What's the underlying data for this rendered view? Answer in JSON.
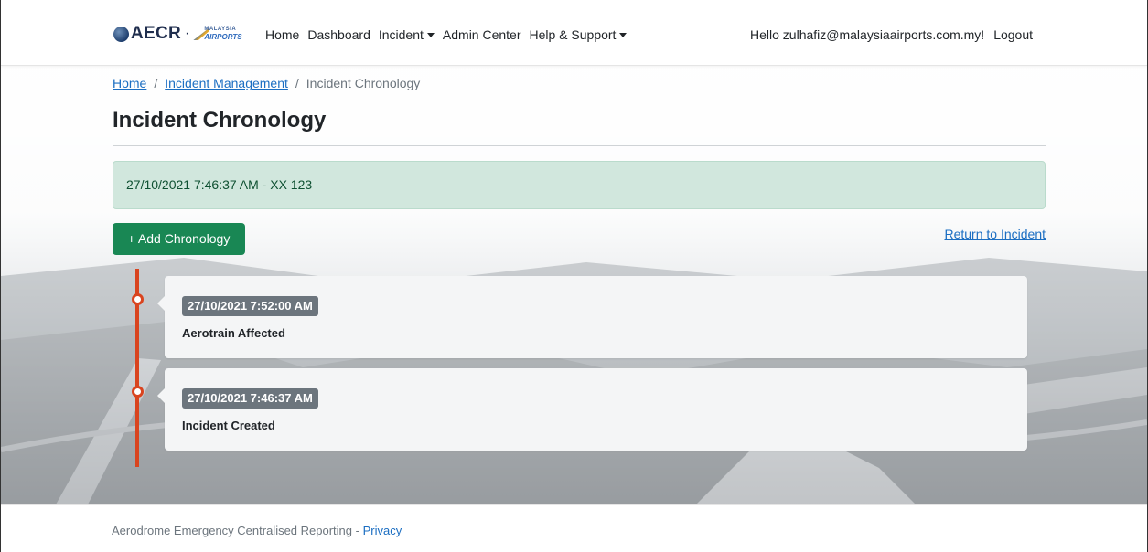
{
  "navbar": {
    "brand": {
      "text": "AECR",
      "separator": "·",
      "logo_small_text": "MALAYSIA",
      "logo_text": "AIRPORTS"
    },
    "links": {
      "home": "Home",
      "dashboard": "Dashboard",
      "incident": "Incident",
      "admin_center": "Admin Center",
      "help_support": "Help & Support"
    },
    "greeting": "Hello zulhafiz@malaysiaairports.com.my!",
    "logout": "Logout"
  },
  "breadcrumb": {
    "home": "Home",
    "incident_management": "Incident Management",
    "current": "Incident Chronology",
    "separator": "/"
  },
  "page": {
    "title": "Incident Chronology",
    "alert_text": "27/10/2021 7:46:37 AM - XX 123",
    "add_button": "+ Add Chronology",
    "return_link": "Return to Incident"
  },
  "timeline": [
    {
      "timestamp": "27/10/2021 7:52:00 AM",
      "description": "Aerotrain Affected"
    },
    {
      "timestamp": "27/10/2021 7:46:37 AM",
      "description": "Incident Created"
    }
  ],
  "footer": {
    "text": "Aerodrome Emergency Centralised Reporting - ",
    "privacy": "Privacy"
  },
  "colors": {
    "primary_link": "#1b6ec2",
    "success_button": "#198754",
    "alert_bg": "#d1e7dd",
    "timeline_accent": "#d9441f",
    "badge_bg": "#6c757d"
  }
}
